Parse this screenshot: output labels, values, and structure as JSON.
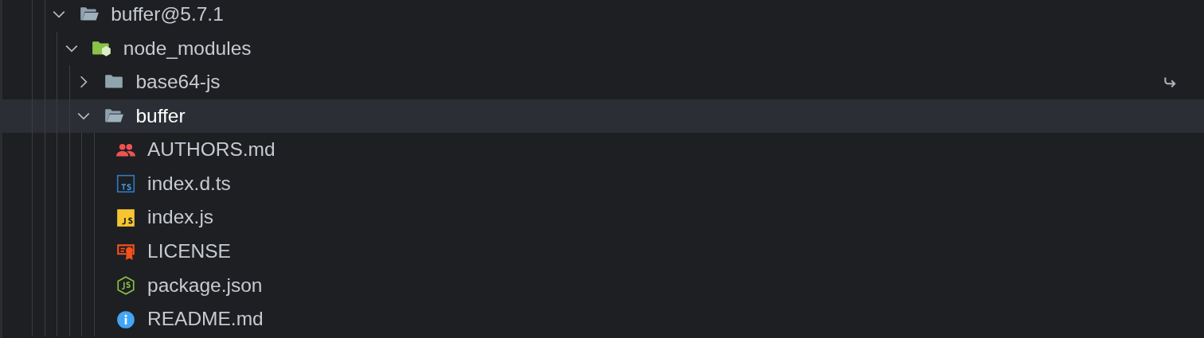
{
  "tree": [
    {
      "label": "buffer@5.7.1",
      "kind": "folder",
      "expanded": true,
      "selected": false,
      "symlink": false,
      "children": [
        {
          "label": "node_modules",
          "kind": "node-folder",
          "expanded": true,
          "selected": false,
          "symlink": false,
          "children": [
            {
              "label": "base64-js",
              "kind": "folder",
              "expanded": false,
              "selected": false,
              "symlink": true
            },
            {
              "label": "buffer",
              "kind": "folder",
              "expanded": true,
              "selected": true,
              "symlink": false,
              "children": [
                {
                  "label": "AUTHORS.md",
                  "kind": "authors",
                  "selected": false,
                  "symlink": false
                },
                {
                  "label": "index.d.ts",
                  "kind": "ts",
                  "selected": false,
                  "symlink": false
                },
                {
                  "label": "index.js",
                  "kind": "js",
                  "selected": false,
                  "symlink": false
                },
                {
                  "label": "LICENSE",
                  "kind": "license",
                  "selected": false,
                  "symlink": false
                },
                {
                  "label": "package.json",
                  "kind": "npm",
                  "selected": false,
                  "symlink": false
                },
                {
                  "label": "README.md",
                  "kind": "readme",
                  "selected": false,
                  "symlink": false
                }
              ]
            }
          ]
        }
      ]
    }
  ]
}
